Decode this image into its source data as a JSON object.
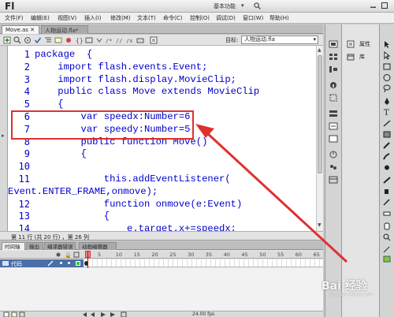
{
  "titlebar": {
    "app_logo": "Fl",
    "workspace": "基本功能",
    "workspace_chevron": "▾"
  },
  "menu": {
    "items": [
      "文件(F)",
      "编辑(E)",
      "视图(V)",
      "插入(I)",
      "修改(M)",
      "文本(T)",
      "命令(C)",
      "控制(O)",
      "调试(D)",
      "窗口(W)",
      "帮助(H)"
    ]
  },
  "tabs": [
    {
      "label": "Move.as ✕"
    },
    {
      "label": "人物运动.fla*"
    }
  ],
  "script_toolbar": {
    "target_label": "目标:",
    "target_value": "人物运动.fla"
  },
  "editor": {
    "lines": [
      {
        "num": "1",
        "text": "package  {"
      },
      {
        "num": "2",
        "text": "    import flash.events.Event;"
      },
      {
        "num": "3",
        "text": "    import flash.display.MovieClip;"
      },
      {
        "num": "4",
        "text": "    public class Move extends MovieClip"
      },
      {
        "num": "5",
        "text": "    {"
      },
      {
        "num": "6",
        "text": "        var speedx:Number=6;"
      },
      {
        "num": "7",
        "text": "        var speedy:Number=5;"
      },
      {
        "num": "8",
        "text": "        public function Move()"
      },
      {
        "num": "9",
        "text": "        {"
      },
      {
        "num": "10",
        "text": ""
      },
      {
        "num": "11",
        "text": "            this.addEventListener("
      },
      {
        "num": "",
        "text": "Event.ENTER_FRAME,onmove);"
      },
      {
        "num": "12",
        "text": "            function onmove(e:Event)"
      },
      {
        "num": "13",
        "text": "            {"
      },
      {
        "num": "14",
        "text": "                e.target.x+=speedx;"
      }
    ]
  },
  "status": {
    "text": "第 11 行 (共 20 行) ，第 26 列"
  },
  "timeline": {
    "tabs": [
      "时间轴",
      "输出",
      "编译器错误",
      "动画编辑器"
    ],
    "frame_numbers": [
      "5",
      "10",
      "15",
      "20",
      "25",
      "30",
      "35",
      "40",
      "45",
      "50",
      "55",
      "60",
      "65"
    ],
    "layer_name": "代码",
    "fps": "24.00 fps"
  },
  "panels": {
    "properties_label": "属性",
    "library_label": "库"
  },
  "watermark": {
    "text": "Bai 经验",
    "sub": "jingyan.baidu.com"
  },
  "colors": {
    "code_text": "#0000cc",
    "annotation": "#e03030",
    "layer_selected": "#4a6ea8"
  }
}
